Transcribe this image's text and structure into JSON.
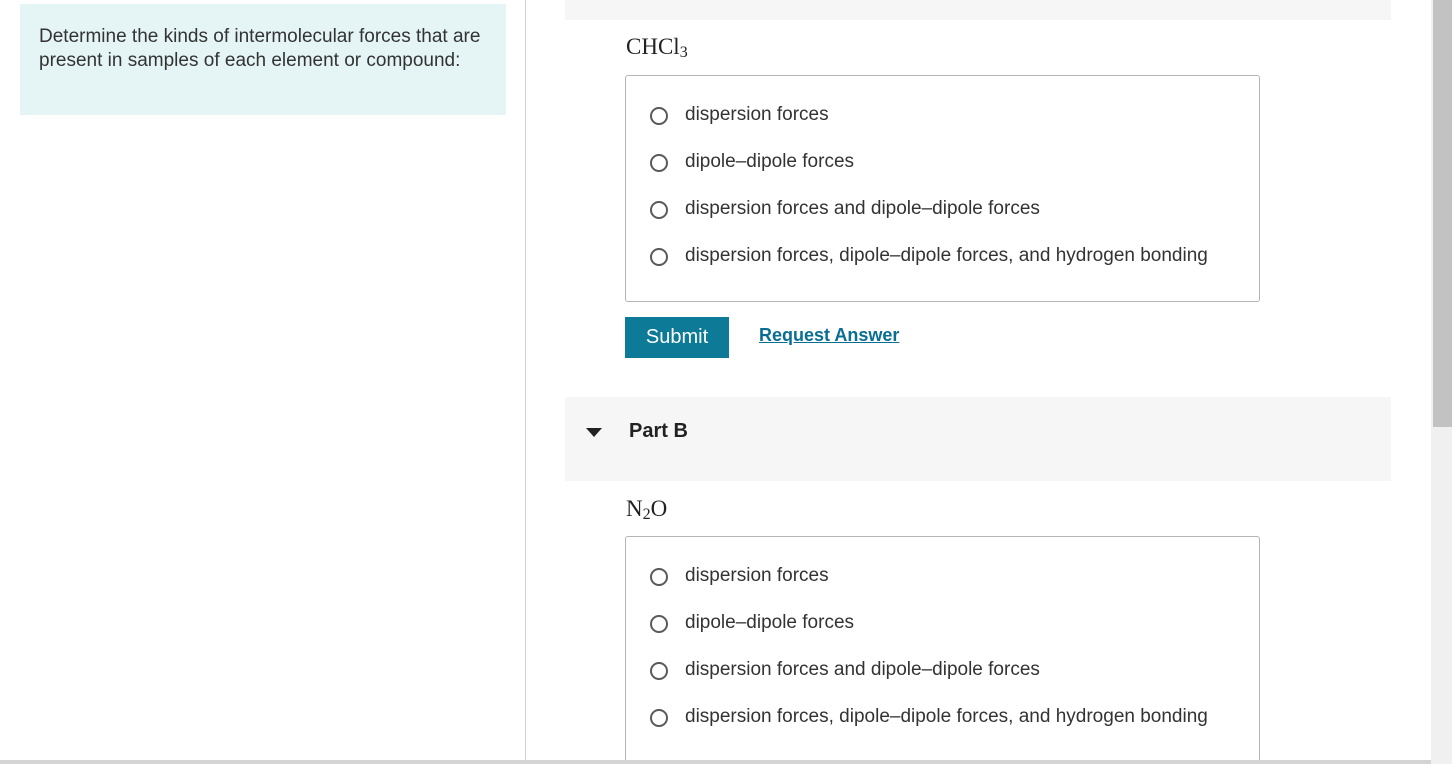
{
  "intro": {
    "text": "Determine the kinds of intermolecular forces that are present in samples of each element or compound:"
  },
  "part_a": {
    "formula_main": "CHCl",
    "formula_sub": "3",
    "options": [
      "dispersion forces",
      "dipole–dipole forces",
      "dispersion forces and dipole–dipole forces",
      "dispersion forces, dipole–dipole forces, and hydrogen bonding"
    ],
    "submit_label": "Submit",
    "request_answer_label": "Request Answer"
  },
  "part_b": {
    "title": "Part B",
    "formula_n": "N",
    "formula_sub": "2",
    "formula_o": "O",
    "options": [
      "dispersion forces",
      "dipole–dipole forces",
      "dispersion forces and dipole–dipole forces",
      "dispersion forces, dipole–dipole forces, and hydrogen bonding"
    ]
  },
  "icons": {
    "caret": "caret-down-icon",
    "radio": "radio-empty-icon"
  },
  "colors": {
    "intro_bg": "#e5f5f6",
    "submit_bg": "#0d7a98",
    "link": "#0a6e94",
    "part_header_bg": "#f6f6f6"
  }
}
